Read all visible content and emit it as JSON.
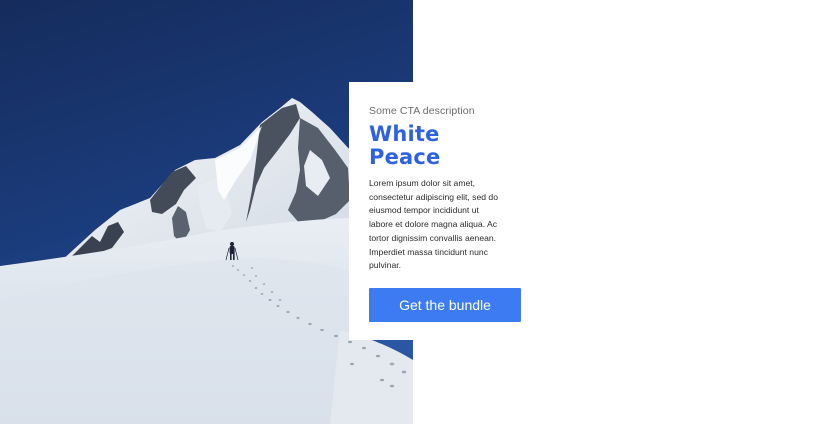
{
  "hero": {
    "image_description": "Snowy mountain peak under a deep blue sky with a lone hiker and footprints in the snow"
  },
  "card": {
    "eyebrow": "Some CTA description",
    "title_lines": [
      "White",
      "Peace"
    ],
    "body_lines": [
      "Lorem ipsum dolor sit amet,",
      "consectetur adipiscing elit, sed do",
      "eiusmod tempor incididunt ut",
      "labore et dolore magna aliqua. Ac",
      "tortor dignissim convallis aenean.",
      "Imperdiet massa tincidunt nunc",
      "pulvinar."
    ],
    "cta_label": "Get the bundle"
  },
  "colors": {
    "accent": "#2f62e0",
    "button": "#3d7bf2",
    "sky": "#17326a"
  }
}
